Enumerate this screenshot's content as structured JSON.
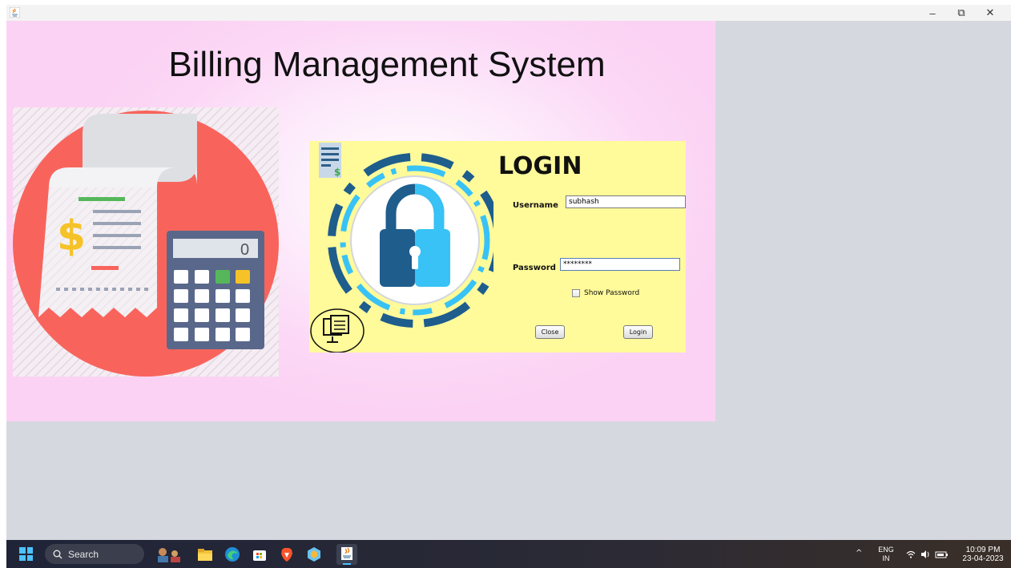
{
  "window": {
    "icon": "java-icon",
    "controls": {
      "minimize": "–",
      "maximize": "⧉",
      "close": "✕"
    }
  },
  "app": {
    "title": "Billing Management System"
  },
  "login": {
    "heading": "LOGIN",
    "username_label": "Username",
    "username_value": "subhash",
    "password_label": "Password",
    "password_value": "********",
    "show_password_label": "Show Password",
    "show_password_checked": false,
    "close_button": "Close",
    "login_button": "Login"
  },
  "taskbar": {
    "search_label": "Search",
    "pinned": [
      "people-icon",
      "file-explorer-icon",
      "edge-icon",
      "store-icon",
      "brave-icon",
      "app-icon",
      "java-icon"
    ],
    "tray": {
      "chevron": "^",
      "language_line1": "ENG",
      "language_line2": "IN",
      "time": "10:09 PM",
      "date": "23-04-2023"
    }
  },
  "colors": {
    "frame_bg": "#fbd2f4",
    "login_panel_bg": "#fffa9a",
    "illustration_circle": "#f8645c",
    "lock_dark": "#1e5d8c",
    "lock_light": "#38c2f5"
  }
}
